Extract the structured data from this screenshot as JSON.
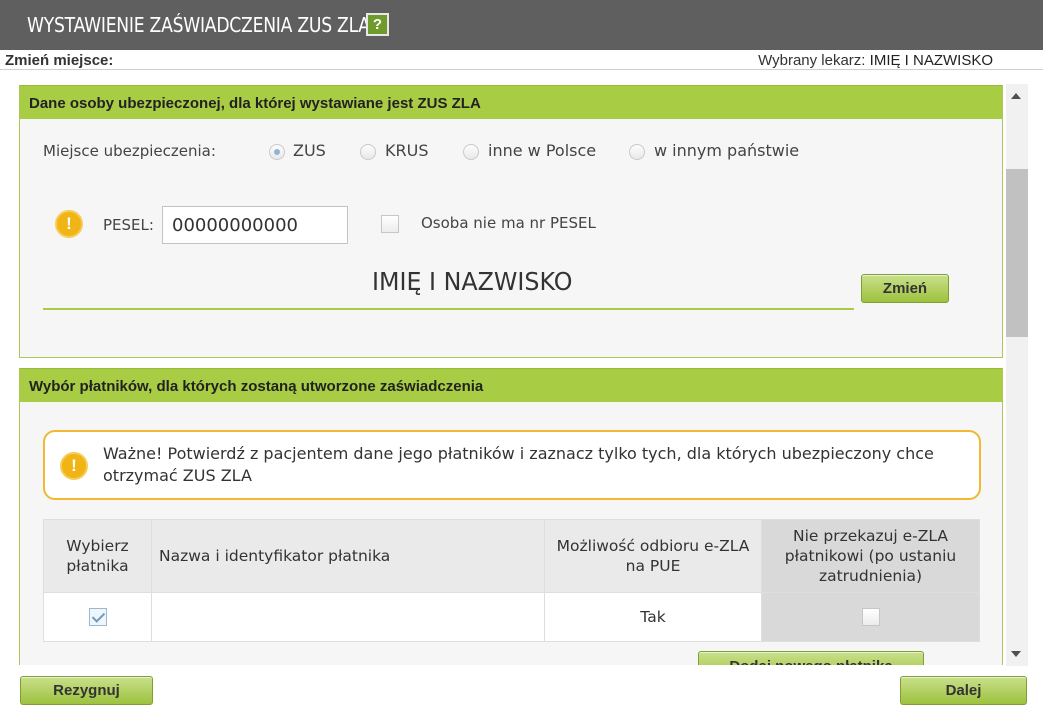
{
  "window": {
    "title": "WYSTAWIENIE ZAŚWIADCZENIA ZUS ZLA",
    "help_label": "?"
  },
  "subheader": {
    "change_place": "Zmień miejsce:",
    "doctor_label": "Wybrany lekarz:",
    "doctor_name": "IMIĘ I NAZWISKO"
  },
  "insured_section": {
    "heading": "Dane osoby ubezpieczonej, dla której wystawiane jest ZUS ZLA",
    "insurance_place_label": "Miejsce ubezpieczenia:",
    "insurance_options": [
      {
        "label": "ZUS",
        "selected": true
      },
      {
        "label": "KRUS",
        "selected": false
      },
      {
        "label": "inne w Polsce",
        "selected": false
      },
      {
        "label": "w innym państwie",
        "selected": false
      }
    ],
    "warning_icon": "!",
    "pesel_label": "PESEL:",
    "pesel_value": "00000000000",
    "no_pesel_label": "Osoba nie ma nr PESEL",
    "no_pesel_checked": false,
    "person_name": "IMIĘ I NAZWISKO",
    "change_button": "Zmień"
  },
  "payers_section": {
    "heading": "Wybór płatników, dla których zostaną utworzone zaświadczenia",
    "notice_icon": "!",
    "notice_text": "Ważne! Potwierdź z pacjentem dane jego płatników i zaznacz tylko tych, dla których ubezpieczony chce otrzymać ZUS ZLA",
    "table": {
      "headers": [
        "Wybierz płatnika",
        "Nazwa i identyfikator płatnika",
        "Możliwość odbioru e-ZLA na PUE",
        "Nie przekazuj e-ZLA płatnikowi (po ustaniu zatrudnienia)"
      ],
      "rows": [
        {
          "selected": true,
          "name": "",
          "pue": "Tak",
          "do_not_send": false
        }
      ]
    },
    "add_payer_button": "Dodaj nowego płatnika"
  },
  "footer": {
    "cancel_button": "Rezygnuj",
    "next_button": "Dalej"
  },
  "colors": {
    "title_bar": "#5f5f5f",
    "section_header": "#a8cd45",
    "warning": "#f0b414"
  }
}
